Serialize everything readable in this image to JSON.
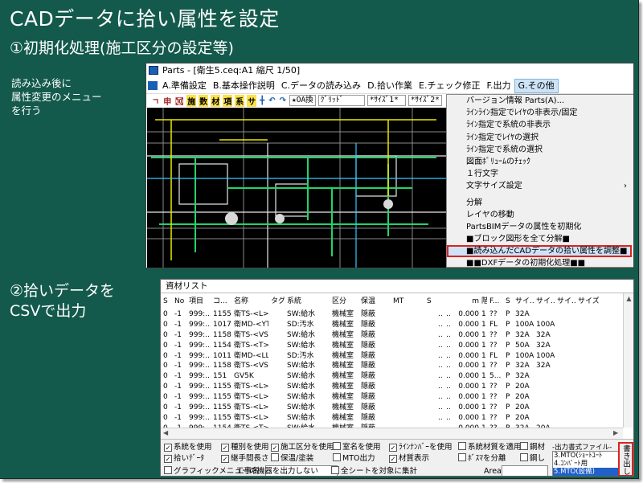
{
  "slide": {
    "title": "CADデータに拾い属性を設定",
    "step1": "①初期化処理(施工区分の設定等)",
    "step2_line1": "②拾いデータを",
    "step2_line2": "CSVで出力",
    "note_lines": [
      "読み込み後に",
      "属性変更のメニュー",
      "を行う"
    ]
  },
  "cad_window": {
    "title": "Parts - [衛生5.ceq:A1 縮尺 1/50]",
    "menu": [
      {
        "label": "A.準備設定",
        "active": false
      },
      {
        "label": "B.基本操作説明",
        "active": false
      },
      {
        "label": "C.データの読み込み",
        "active": false
      },
      {
        "label": "D.拾い作業",
        "active": false
      },
      {
        "label": "E.チェック修正",
        "active": false
      },
      {
        "label": "F.出力",
        "active": false
      },
      {
        "label": "G.その他",
        "active": true
      }
    ],
    "toolbar": {
      "tools": [
        "ㄱ",
        "申",
        "㉈",
        "施",
        "数",
        "材",
        "項",
        "系",
        "サ",
        "╋",
        "↶",
        "↷"
      ],
      "select1": "★OA換",
      "select2": "ｸﾞﾘｯﾄﾞ",
      "select3": "*ｻｲｽﾞ1*",
      "select4": "*ｻｲｽﾞ2*"
    },
    "dropdown": [
      {
        "label": "バージョン情報 Parts(A)...",
        "type": "item"
      },
      {
        "label": "ﾗｲﾝﾗｲﾝ指定でﾚｲﾔの非表示/固定",
        "type": "item"
      },
      {
        "label": "ﾗｲﾝ指定で系統の非表示",
        "type": "item"
      },
      {
        "label": "ﾗｲﾝ指定でﾚｲﾔの選択",
        "type": "item"
      },
      {
        "label": "ﾗｲﾝ指定で系統の選択",
        "type": "item"
      },
      {
        "label": "図面ﾎﾞﾘｭｰﾑのﾁｪｯｸ",
        "type": "item"
      },
      {
        "label": "１行文字",
        "type": "item"
      },
      {
        "label": "文字サイズ設定",
        "type": "submenu"
      },
      {
        "label": "",
        "type": "sep"
      },
      {
        "label": "分解",
        "type": "item"
      },
      {
        "label": "レイヤの移動",
        "type": "item"
      },
      {
        "label": "PartsBIMデータの属性を初期化",
        "type": "item"
      },
      {
        "label": "■ブロック図形を全て分解■",
        "type": "item"
      },
      {
        "label": "■読み込んだCADデータの拾い属性を調整■",
        "type": "highlight"
      },
      {
        "label": "■■DXFデータの初期化処理■■",
        "type": "item"
      }
    ]
  },
  "parts_list": {
    "title": "資材リスト",
    "columns": [
      "S",
      "No",
      "項目",
      "コ...",
      "名称",
      "タグ",
      "系統",
      "区分",
      "保温",
      "MT",
      "S",
      "",
      "",
      "m",
      "階",
      "F...",
      "S",
      "サイ...",
      "サイ...",
      "サイ...",
      "サイズ"
    ],
    "rows": [
      [
        "0",
        "-1",
        "999:...",
        "1155",
        "衛TS-<L>エル...",
        "",
        "SW:給水",
        "機械室",
        "隠蔽",
        "",
        "",
        "..",
        "..",
        "0.000",
        "1",
        "??",
        "P",
        "32A",
        "",
        "",
        ""
      ],
      [
        "0",
        "-1",
        "999:...",
        "1017",
        "衛MD-<YT>90...",
        "",
        "SD:汚水",
        "機械室",
        "隠蔽",
        "",
        "",
        "..",
        "..",
        "0.000",
        "1",
        "FL",
        "P",
        "100A",
        "100A",
        "",
        ""
      ],
      [
        "0",
        "-1",
        "999:...",
        "1158",
        "衛TS-<VS>バ...",
        "",
        "SW:給水",
        "機械室",
        "隠蔽",
        "",
        "",
        "..",
        "..",
        "0.000",
        "1",
        "??",
        "P",
        "32A",
        "32A",
        "",
        ""
      ],
      [
        "0",
        "-1",
        "999:...",
        "1154",
        "衛TS-<T>チー...",
        "",
        "SW:給水",
        "機械室",
        "隠蔽",
        "",
        "",
        "..",
        "..",
        "0.000",
        "1",
        "??",
        "P",
        "50A",
        "32A",
        "",
        ""
      ],
      [
        "0",
        "-1",
        "999:...",
        "1011",
        "衛MD-<LL>9...",
        "",
        "SD:汚水",
        "機械室",
        "隠蔽",
        "",
        "",
        "..",
        "..",
        "0.000",
        "1",
        "FL",
        "P",
        "100A",
        "100A",
        "",
        ""
      ],
      [
        "0",
        "-1",
        "999:...",
        "1158",
        "衛TS-<VS>バ...",
        "",
        "SW:給水",
        "機械室",
        "隠蔽",
        "",
        "",
        "..",
        "..",
        "0.000",
        "1",
        "??",
        "P",
        "32A",
        "32A",
        "",
        ""
      ],
      [
        "0",
        "-1",
        "999:...",
        "151",
        "GV5K",
        "",
        "SW:給水",
        "機械室",
        "隠蔽",
        "",
        "",
        "..",
        "..",
        "0.000",
        "1",
        "5...",
        "P",
        "32A",
        "",
        "",
        ""
      ],
      [
        "0",
        "-1",
        "999:...",
        "1155",
        "衛TS-<L>エル...",
        "",
        "SW:給水",
        "機械室",
        "隠蔽",
        "",
        "",
        "..",
        "..",
        "0.000",
        "1",
        "??",
        "P",
        "20A",
        "",
        "",
        ""
      ],
      [
        "0",
        "-1",
        "999:...",
        "1155",
        "衛TS-<L>エル...",
        "",
        "SW:給水",
        "機械室",
        "隠蔽",
        "",
        "",
        "..",
        "..",
        "0.000",
        "1",
        "??",
        "P",
        "20A",
        "",
        "",
        ""
      ],
      [
        "0",
        "-1",
        "999:...",
        "1155",
        "衛TS-<L>エル...",
        "",
        "SW:給水",
        "機械室",
        "隠蔽",
        "",
        "",
        "..",
        "..",
        "0.000",
        "1",
        "??",
        "P",
        "20A",
        "",
        "",
        ""
      ],
      [
        "0",
        "-1",
        "999:...",
        "1155",
        "衛TS-<L>エル...",
        "",
        "SW:給水",
        "機械室",
        "隠蔽",
        "",
        "",
        "..",
        "..",
        "0.000",
        "1",
        "??",
        "P",
        "20A",
        "",
        "",
        ""
      ],
      [
        "0",
        "-1",
        "999:...",
        "1154",
        "衛TS-<T>チー...",
        "",
        "SW:給水",
        "機械室",
        "隠蔽",
        "",
        "",
        "..",
        "..",
        "0.000",
        "1",
        "??",
        "P",
        "32A",
        "20A",
        "",
        ""
      ],
      [
        "0",
        "-1",
        "999:...",
        "1014",
        "衛MD-<L45°>...",
        "",
        "SD:汚水",
        "機械室",
        "隠蔽",
        "",
        "",
        "..",
        "..",
        "0.000",
        "1",
        "FL",
        "P",
        "80A",
        "",
        "",
        ""
      ]
    ],
    "options": [
      {
        "label": "系統を使用",
        "checked": true
      },
      {
        "label": "種別を使用",
        "checked": true
      },
      {
        "label": "施工区分を使用",
        "checked": true
      },
      {
        "label": "室名を使用",
        "checked": false
      },
      {
        "label": "ﾗｲﾝﾅﾝﾊﾞｰを使用",
        "checked": true
      },
      {
        "label": "系統材質を適用",
        "checked": false
      },
      {
        "label": "鋼材",
        "checked": false
      },
      {
        "label": "拾いﾃﾞｰﾀ",
        "checked": true
      },
      {
        "label": "継手間長さ",
        "checked": true
      },
      {
        "label": "保温/塗装",
        "checked": false
      },
      {
        "label": "MTO出力",
        "checked": false
      },
      {
        "label": "材質表示",
        "checked": true
      },
      {
        "label": "ﾎﾞｽﾏを分離",
        "checked": false
      },
      {
        "label": "鋼し",
        "checked": false
      },
      {
        "label": "グラフィックメニューの機器を出力しない",
        "checked": false
      },
      {
        "label": "全シートを対象に集計",
        "checked": false
      }
    ],
    "koji_label": "工事名",
    "area_label": "Area",
    "format_header": "-出力書式ファイル-",
    "format_items": [
      "3.MTO(ｼｮｰﾄﾕｰﾄ",
      "4.ｺﾝﾊﾟｰﾄ用",
      "5.MTO(設備)"
    ],
    "format_selected": 2,
    "write_button": "書き出し"
  }
}
